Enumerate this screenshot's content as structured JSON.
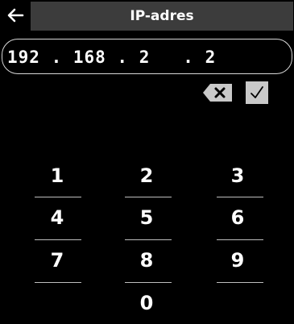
{
  "header": {
    "title": "IP-adres"
  },
  "ip_field": {
    "value": "192 . 168 . 2   . 2"
  },
  "keypad": {
    "keys": [
      "1",
      "2",
      "3",
      "4",
      "5",
      "6",
      "7",
      "8",
      "9",
      "0"
    ]
  },
  "icons": {
    "back": "back-arrow-icon",
    "backspace": "backspace-icon",
    "confirm": "checkmark-icon"
  },
  "colors": {
    "background": "#000000",
    "header": "#3c3c3c",
    "confirm_button": "#c9c9c9",
    "backspace_button": "#c9c9c9"
  }
}
